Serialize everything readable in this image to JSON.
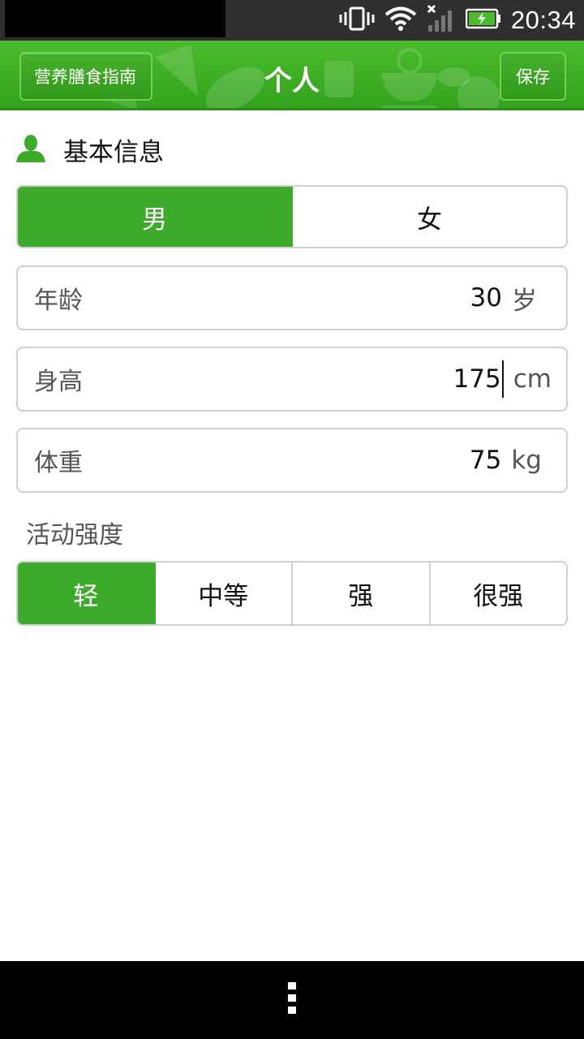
{
  "status_bar": {
    "time": "20:34",
    "icons": [
      "vibrate-icon",
      "wifi-icon",
      "signal-icon",
      "battery-charging-icon"
    ]
  },
  "action_bar": {
    "back_label": "营养膳食指南",
    "title": "个人",
    "save_label": "保存"
  },
  "basic_info": {
    "icon": "person-icon",
    "title": "基本信息"
  },
  "gender": {
    "options": [
      "男",
      "女"
    ],
    "selected": "男"
  },
  "fields": {
    "age": {
      "label": "年龄",
      "value": "30",
      "unit": "岁"
    },
    "height": {
      "label": "身高",
      "value": "175",
      "unit": "cm"
    },
    "weight": {
      "label": "体重",
      "value": "75",
      "unit": "kg"
    }
  },
  "activity": {
    "label": "活动强度",
    "options": [
      "轻",
      "中等",
      "强",
      "很强"
    ],
    "selected": "轻"
  },
  "colors": {
    "accent": "#3daa2b",
    "action_bar": "#3fae24",
    "status_bar": "#2f2f2f"
  }
}
